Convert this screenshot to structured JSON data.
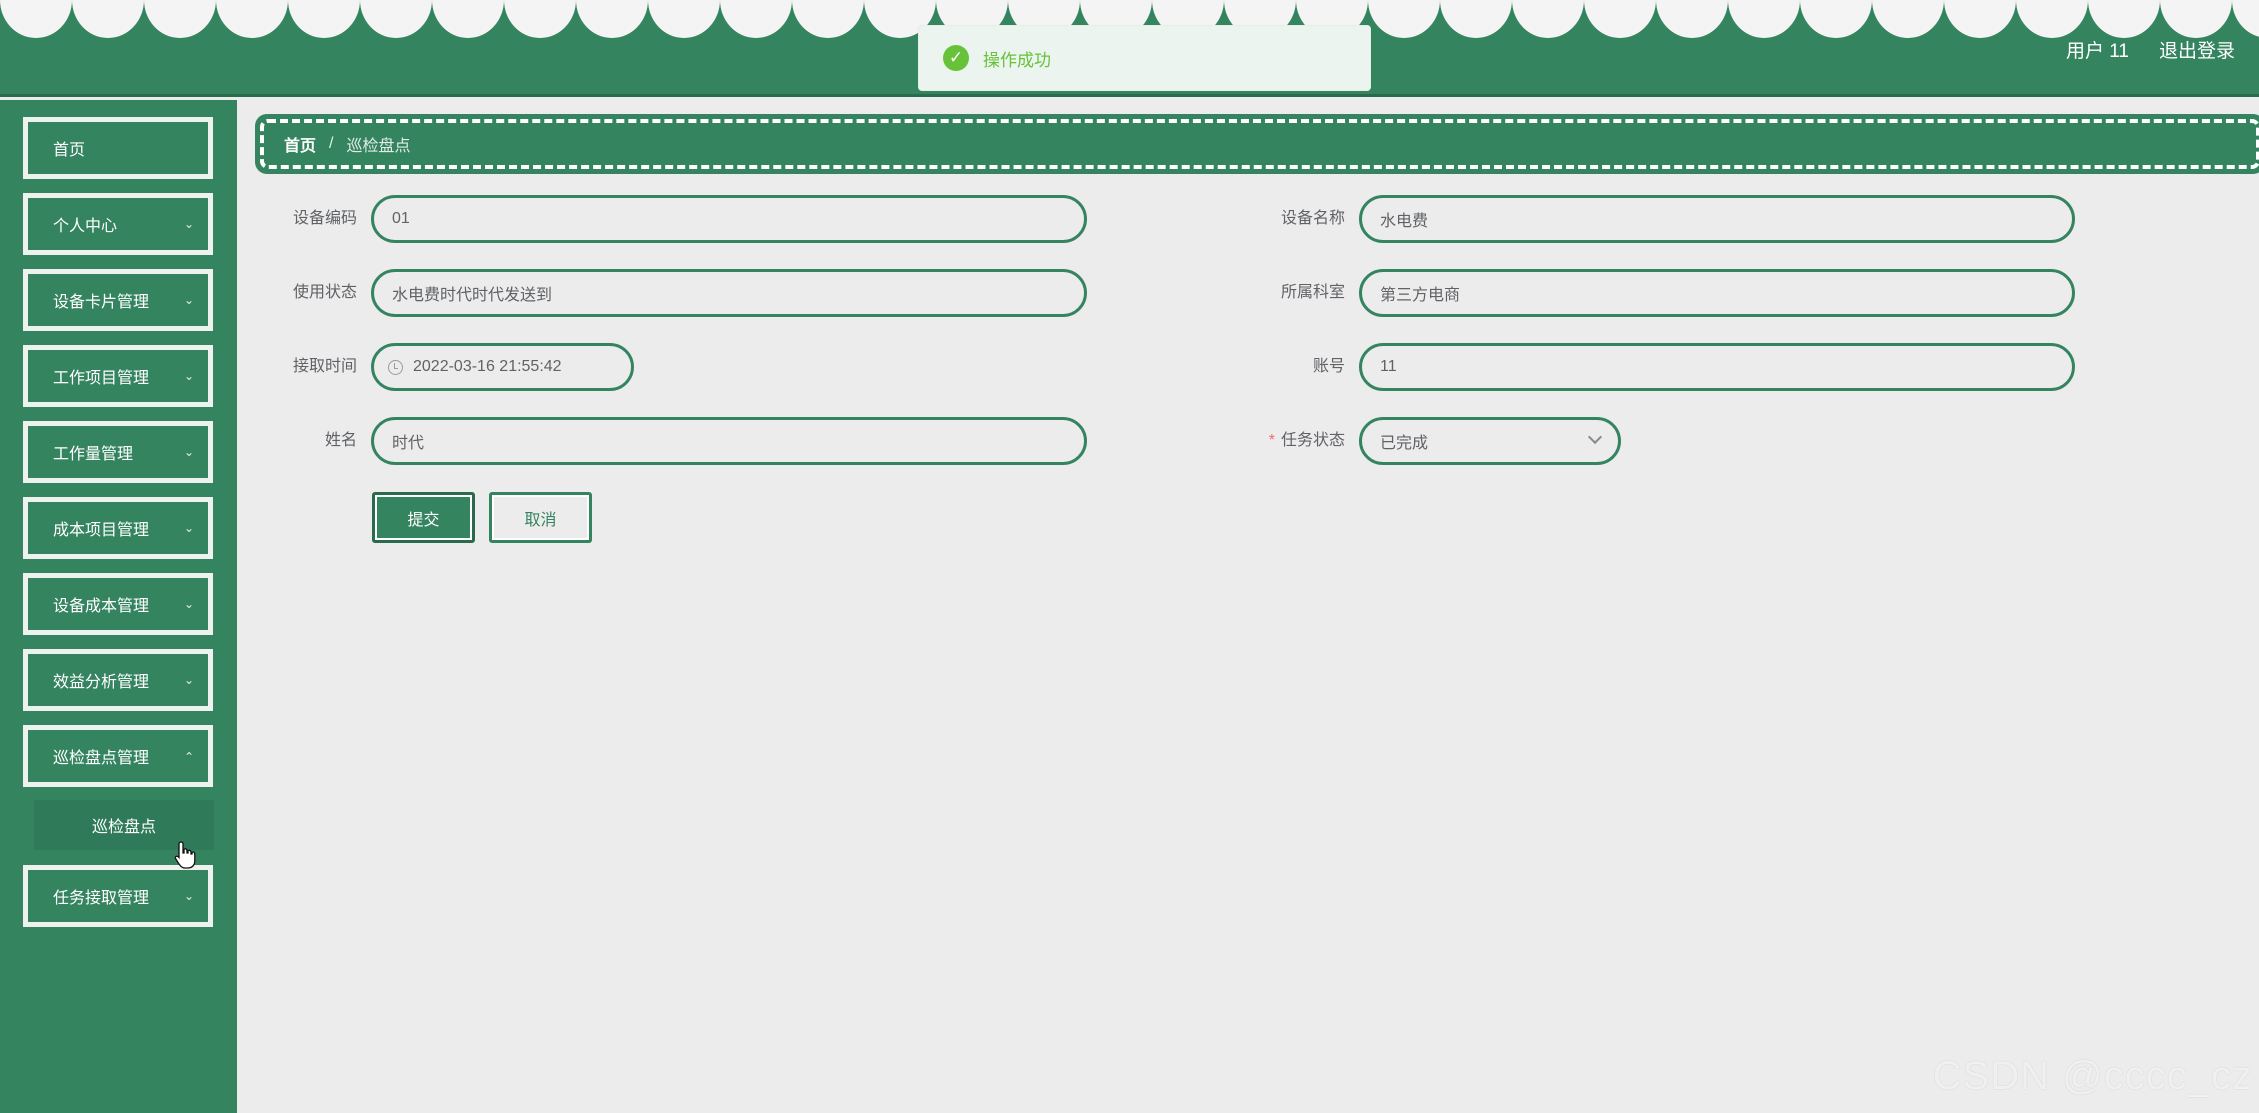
{
  "colors": {
    "brand": "#358460",
    "background": "#ececec",
    "success": "#67c23a",
    "required": "#f56c6c"
  },
  "header": {
    "user_label": "用户 11",
    "logout_label": "退出登录"
  },
  "toast": {
    "icon": "check-circle-icon",
    "message": "操作成功"
  },
  "sidebar": {
    "items": [
      {
        "label": "首页",
        "has_children": false
      },
      {
        "label": "个人中心",
        "has_children": true
      },
      {
        "label": "设备卡片管理",
        "has_children": true
      },
      {
        "label": "工作项目管理",
        "has_children": true
      },
      {
        "label": "工作量管理",
        "has_children": true
      },
      {
        "label": "成本项目管理",
        "has_children": true
      },
      {
        "label": "设备成本管理",
        "has_children": true
      },
      {
        "label": "效益分析管理",
        "has_children": true
      },
      {
        "label": "巡检盘点管理",
        "has_children": true,
        "expanded": true
      },
      {
        "label": "任务接取管理",
        "has_children": true
      }
    ],
    "submenu": {
      "label": "巡检盘点"
    }
  },
  "breadcrumb": {
    "home": "首页",
    "separator": "/",
    "current": "巡检盘点"
  },
  "form": {
    "device_code": {
      "label": "设备编码",
      "value": "01"
    },
    "device_name": {
      "label": "设备名称",
      "value": "水电费"
    },
    "usage_status": {
      "label": "使用状态",
      "value": "水电费时代时代发送到"
    },
    "department": {
      "label": "所属科室",
      "value": "第三方电商"
    },
    "pickup_time": {
      "label": "接取时间",
      "value": "2022-03-16 21:55:42"
    },
    "account": {
      "label": "账号",
      "value": "11"
    },
    "name": {
      "label": "姓名",
      "value": "时代"
    },
    "task_status": {
      "label": "任务状态",
      "required_mark": "*",
      "value": "已完成"
    }
  },
  "buttons": {
    "submit": "提交",
    "cancel": "取消"
  },
  "watermark": "CSDN @cccc_cz"
}
